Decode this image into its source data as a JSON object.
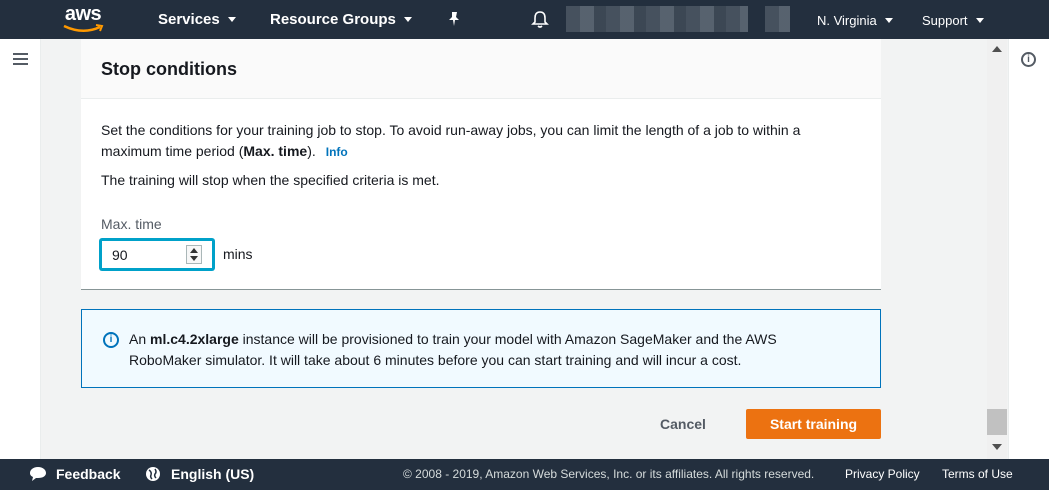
{
  "header": {
    "logo_text": "aws",
    "services_label": "Services",
    "resource_groups_label": "Resource Groups",
    "region_label": "N. Virginia",
    "support_label": "Support"
  },
  "panel": {
    "title": "Stop conditions",
    "description_prefix": "Set the conditions for your training job to stop. To avoid run-away jobs, you can limit the length of a job to within a maximum time period (",
    "description_bold": "Max. time",
    "description_suffix": ").",
    "info_link": "Info",
    "criteria_text": "The training will stop when the specified criteria is met.",
    "max_time_label": "Max. time",
    "max_time_value": "90",
    "max_time_unit": "mins"
  },
  "alert": {
    "text_prefix": "An ",
    "instance_type": "ml.c4.2xlarge",
    "text_suffix": " instance will be provisioned to train your model with Amazon SageMaker and the AWS RoboMaker simulator. It will take about 6 minutes before you can start training and will incur a cost."
  },
  "actions": {
    "cancel_label": "Cancel",
    "start_label": "Start training"
  },
  "footer": {
    "feedback_label": "Feedback",
    "language_label": "English (US)",
    "copyright": "© 2008 - 2019, Amazon Web Services, Inc. or its affiliates. All rights reserved.",
    "privacy_label": "Privacy Policy",
    "terms_label": "Terms of Use"
  },
  "colors": {
    "nav_bg": "#232f3e",
    "accent_orange": "#ec7211",
    "link_blue": "#0073bb",
    "focus_cyan": "#00a1c9",
    "alert_bg": "#f1faff"
  },
  "icons": {
    "bell": "bell-icon",
    "pin": "pin-icon",
    "hamburger": "hamburger-menu-icon",
    "info": "info-icon",
    "chat": "chat-bubble-icon",
    "globe": "globe-icon"
  }
}
